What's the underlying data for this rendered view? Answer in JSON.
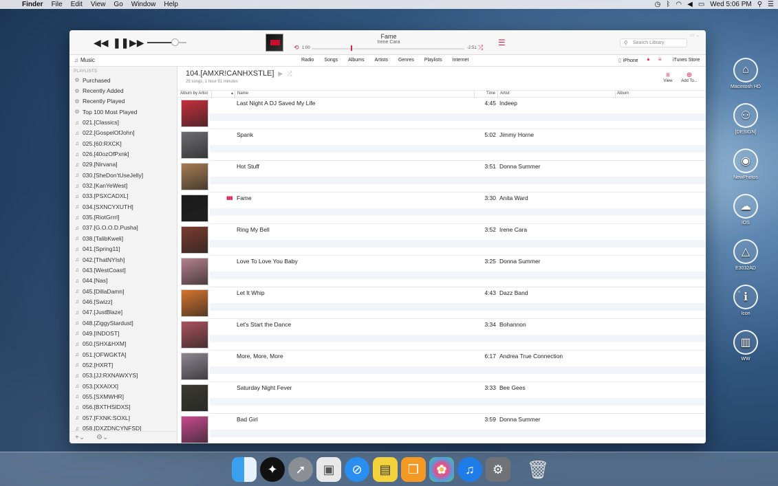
{
  "menubar": {
    "app": "Finder",
    "items": [
      "File",
      "Edit",
      "View",
      "Go",
      "Window",
      "Help"
    ],
    "clock": "Wed 5:06 PM"
  },
  "player": {
    "title": "Fame",
    "artist": "Irene Cara",
    "elapsed": "1:00",
    "remaining": "-2:51",
    "search_placeholder": "Search Library"
  },
  "nav": {
    "source": "Music",
    "tabs": [
      "Radio",
      "Songs",
      "Albums",
      "Artists",
      "Genres",
      "Playlists",
      "Internet"
    ],
    "device": "iPhone",
    "store": "iTunes Store"
  },
  "sidebar": {
    "header": "PLAYLISTS",
    "smart": [
      "Purchased",
      "Recently Added",
      "Recently Played",
      "Top 100 Most Played"
    ],
    "playlists": [
      "021.[Classics]",
      "022.[GospelOfJohn]",
      "025.[60:RXCK]",
      "026.[40ozOfPxnk]",
      "029.[Nirvana]",
      "030.[SheDon'tUseJelly]",
      "032.[KanYeWest]",
      "033.[PSXCADXL]",
      "034.[SXNCYXUTH]",
      "035.[RiotGrrrl]",
      "037.[G.O.O.D.Pusha]",
      "038.[TalibKweli]",
      "041.[Spring11]",
      "042.[ThatNYIsh]",
      "043.[WestCoast]",
      "044.[Nas]",
      "045.[DillaDamn]",
      "046.[Swizz]",
      "047.[JustBlaze]",
      "048.[ZiggyStardust]",
      "049.[INDOST]",
      "050.[SHX&HXM]",
      "051.[OFWGKTA]",
      "052.[HXRT]",
      "053.[JJ:RXNAWXYS]",
      "053.[XXAIXX]",
      "055.[SXMWHR]",
      "056.[BXTHSIDXS]",
      "057.[FXNK:SOXL]",
      "058.[DXZDNCYNFSD]"
    ]
  },
  "playlist": {
    "title": "104.[AMXR!CANHXSTLE]",
    "subtitle": "25 songs, 1 hour 51 minutes",
    "view_label": "View",
    "add_label": "Add To..."
  },
  "columns": {
    "album_by_artist": "Album by Artist",
    "name": "Name",
    "time": "Time",
    "artist": "Artist",
    "album": "Album"
  },
  "tracks": [
    {
      "name": "Last Night A DJ Saved My Life",
      "time": "4:45",
      "artist": "Indeep",
      "color": "#c62f3a"
    },
    {
      "name": "Spank",
      "time": "5:02",
      "artist": "Jimmy Horne",
      "color": "#6d6d72"
    },
    {
      "name": "Hot Stuff",
      "time": "3:51",
      "artist": "Donna Summer",
      "color": "#a67c52"
    },
    {
      "name": "Fame",
      "time": "3:30",
      "artist": "Anita Ward",
      "color": "#1a1a1a"
    },
    {
      "name": "Ring My Bell",
      "time": "3:52",
      "artist": "Irene Cara",
      "color": "#7a3b2e"
    },
    {
      "name": "Love To Love You Baby",
      "time": "3:25",
      "artist": "Donna Summer",
      "color": "#b4808c"
    },
    {
      "name": "Let It Whip",
      "time": "4:43",
      "artist": "Dazz Band",
      "color": "#d4742c"
    },
    {
      "name": "Let's Start the Dance",
      "time": "3:34",
      "artist": "Bohannon",
      "color": "#a8525a"
    },
    {
      "name": "More, More, More",
      "time": "6:17",
      "artist": "Andrea True Connection",
      "color": "#8d8690"
    },
    {
      "name": "Saturday Night Fever",
      "time": "3:33",
      "artist": "Bee Gees",
      "color": "#3a3a30"
    },
    {
      "name": "Bad Girl",
      "time": "3:59",
      "artist": "Donna Summer",
      "color": "#c64a8e"
    }
  ],
  "desktop_icons": [
    "Macintosh HD",
    "[DESIGN]",
    "NewPhotos",
    "iOS",
    "E3032AD",
    "Icon",
    "WW"
  ]
}
